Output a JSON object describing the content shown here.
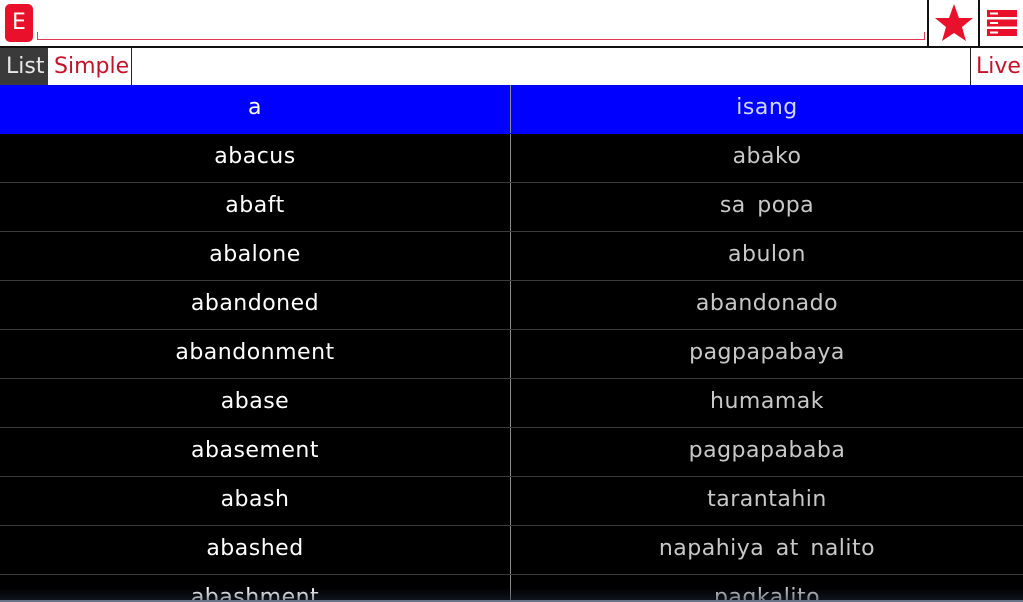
{
  "toolbar": {
    "language_button": "E",
    "search_value": "",
    "star_icon": "star-icon",
    "menu_icon": "menu-icon",
    "accent_color": "#e8102a"
  },
  "tabs": {
    "list": "List",
    "simple": "Simple",
    "live": "Live"
  },
  "entries": [
    {
      "en": "a",
      "tl": "isang",
      "selected": true
    },
    {
      "en": "abacus",
      "tl": "abako"
    },
    {
      "en": "abaft",
      "tl": "sa popa"
    },
    {
      "en": "abalone",
      "tl": "abulon"
    },
    {
      "en": "abandoned",
      "tl": "abandonado"
    },
    {
      "en": "abandonment",
      "tl": "pagpapabaya"
    },
    {
      "en": "abase",
      "tl": "humamak"
    },
    {
      "en": "abasement",
      "tl": "pagpapababa"
    },
    {
      "en": "abash",
      "tl": "tarantahin"
    },
    {
      "en": "abashed",
      "tl": "napahiya at nalito"
    },
    {
      "en": "abashment",
      "tl": "pagkalito"
    }
  ]
}
